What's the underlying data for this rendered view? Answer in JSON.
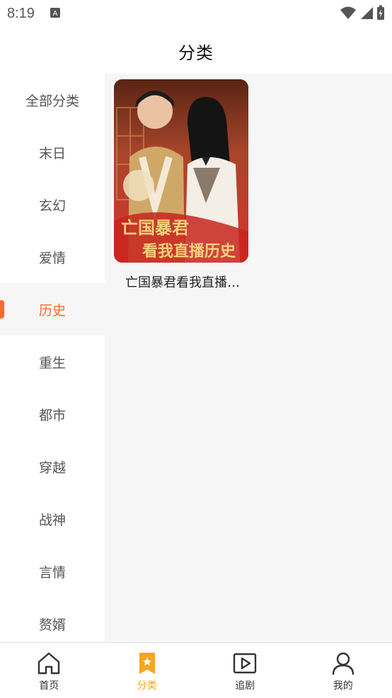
{
  "status_bar": {
    "time": "8:19",
    "icons": [
      "notification-icon",
      "wifi-icon",
      "signal-icon",
      "battery-icon"
    ]
  },
  "header": {
    "title": "分类"
  },
  "sidebar": {
    "items": [
      {
        "label": "全部分类"
      },
      {
        "label": "末日"
      },
      {
        "label": "玄幻"
      },
      {
        "label": "爱情"
      },
      {
        "label": "历史"
      },
      {
        "label": "重生"
      },
      {
        "label": "都市"
      },
      {
        "label": "穿越"
      },
      {
        "label": "战神"
      },
      {
        "label": "言情"
      },
      {
        "label": "赘婿"
      }
    ],
    "selected": "历史"
  },
  "content": {
    "cards": [
      {
        "title": "亡国暴君看我直播历史",
        "poster_text": "亡国暴君看我直播历史"
      }
    ]
  },
  "bottom_nav": {
    "items": [
      {
        "label": "首页",
        "icon": "home-icon"
      },
      {
        "label": "分类",
        "icon": "category-bookmark-icon"
      },
      {
        "label": "追剧",
        "icon": "play-icon"
      },
      {
        "label": "我的",
        "icon": "profile-icon"
      }
    ],
    "active": "分类"
  },
  "colors": {
    "accent": "#ff6a2b",
    "nav_active": "#f5a623",
    "content_bg": "#f6f6f6"
  }
}
